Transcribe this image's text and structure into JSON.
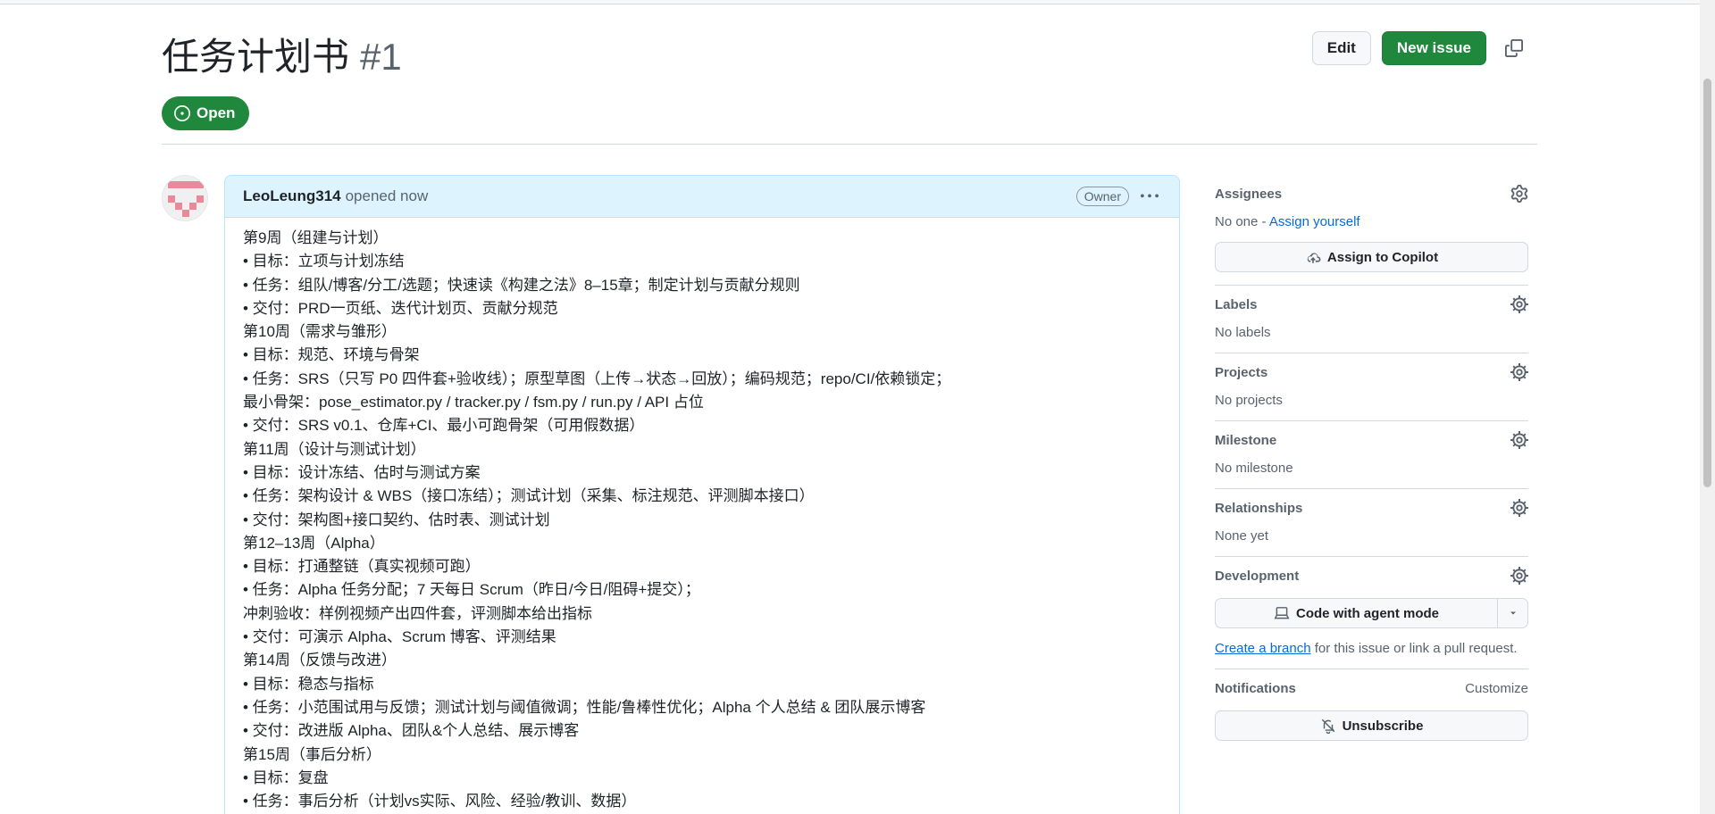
{
  "issue": {
    "title": "任务计划书",
    "number": "#1",
    "state": "Open"
  },
  "header_actions": {
    "edit_label": "Edit",
    "new_issue_label": "New issue"
  },
  "comment": {
    "author": "LeoLeung314",
    "time": "opened now",
    "role_badge": "Owner",
    "lines": [
      "第9周（组建与计划）",
      "• 目标：立项与计划冻结",
      "• 任务：组队/博客/分工/选题；快速读《构建之法》8–15章；制定计划与贡献分规则",
      "• 交付：PRD一页纸、迭代计划页、贡献分规范",
      "第10周（需求与雏形）",
      "• 目标：规范、环境与骨架",
      "• 任务：SRS（只写 P0 四件套+验收线）；原型草图（上传→状态→回放）；编码规范；repo/CI/依赖锁定；",
      "最小骨架：pose_estimator.py / tracker.py / fsm.py / run.py / API 占位",
      "• 交付：SRS v0.1、仓库+CI、最小可跑骨架（可用假数据）",
      "第11周（设计与测试计划）",
      "• 目标：设计冻结、估时与测试方案",
      "• 任务：架构设计 & WBS（接口冻结）；测试计划（采集、标注规范、评测脚本接口）",
      "• 交付：架构图+接口契约、估时表、测试计划",
      "第12–13周（Alpha）",
      "• 目标：打通整链（真实视频可跑）",
      "• 任务：Alpha 任务分配；7 天每日 Scrum（昨日/今日/阻碍+提交）；",
      "冲刺验收：样例视频产出四件套，评测脚本给出指标",
      "• 交付：可演示 Alpha、Scrum 博客、评测结果",
      "第14周（反馈与改进）",
      "• 目标：稳态与指标",
      "• 任务：小范围试用与反馈；测试计划与阈值微调；性能/鲁棒性优化；Alpha 个人总结 & 团队展示博客",
      "• 交付：改进版 Alpha、团队&个人总结、展示博客",
      "第15周（事后分析）",
      "• 目标：复盘",
      "• 任务：事后分析（计划vs实际、风险、经验/教训、数据）"
    ]
  },
  "sidebar": {
    "assignees": {
      "heading": "Assignees",
      "none_text": "No one -",
      "assign_self": "Assign yourself",
      "copilot_button": "Assign to Copilot"
    },
    "labels": {
      "heading": "Labels",
      "value": "No labels"
    },
    "projects": {
      "heading": "Projects",
      "value": "No projects"
    },
    "milestone": {
      "heading": "Milestone",
      "value": "No milestone"
    },
    "relationships": {
      "heading": "Relationships",
      "value": "None yet"
    },
    "development": {
      "heading": "Development",
      "button": "Code with agent mode",
      "create_branch": "Create a branch",
      "link_text": "for this issue or link a pull request."
    },
    "notifications": {
      "heading": "Notifications",
      "customize": "Customize",
      "unsubscribe": "Unsubscribe"
    }
  },
  "colors": {
    "accent_green": "#1f883d",
    "link_blue": "#0969da",
    "comment_header_bg": "#ddf4ff"
  }
}
